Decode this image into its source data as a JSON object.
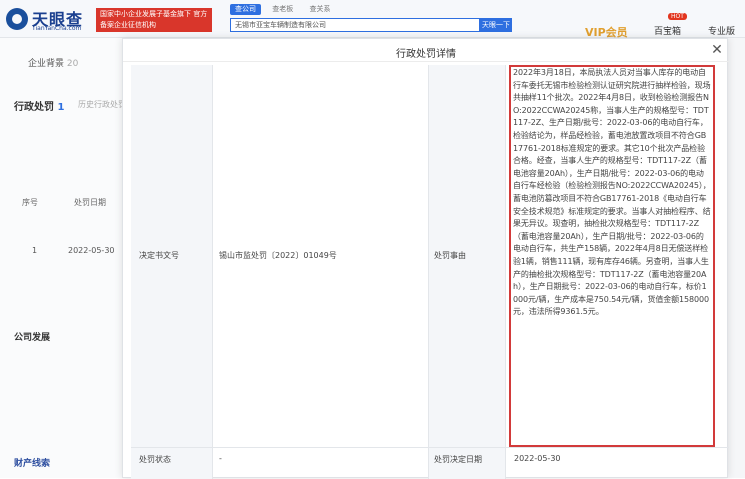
{
  "header": {
    "logo_text": "天眼查",
    "logo_sub": "TianYanCha.com",
    "ad_banner": "国家中小企业发展子基金旗下 官方备案企业征信机构",
    "search_tabs": [
      "查公司",
      "查老板",
      "查关系"
    ],
    "search_value": "无锡市亚宝车辆制造有限公司",
    "search_button": "天眼一下",
    "vip_label": "VIP会员",
    "hot_badge": "HOT",
    "nav_label": "百宝箱",
    "pro_label": "专业版"
  },
  "background": {
    "tab_label": "企业背景",
    "tab_count": "20",
    "section_title": "行政处罚",
    "section_count": "1",
    "section_sub": "历史行政处罚",
    "table_headers": [
      "序号",
      "处罚日期"
    ],
    "table_row": [
      "1",
      "2022-05-30"
    ],
    "section_2": "公司发展",
    "section_3": "财产线索"
  },
  "modal": {
    "title": "行政处罚详情",
    "rows": {
      "decision_label": "决定书文号",
      "decision_value": "锡山市监处罚〔2022〕01049号",
      "reason_label": "处罚事由",
      "reason_text": "2022年3月18日，本局执法人员对当事人库存的电动自行车委托无锡市检验检测认证研究院进行抽样检验，现场共抽样11个批次。2022年4月8日，收到检验检测报告NO:2022CCWA20245称，当事人生产的规格型号：TDT117-2Z、生产日期/批号：2022-03-06的电动自行车，检验结论为，样品经检验，蓄电池放置改项目不符合GB17761-2018标准规定的要求。其它10个批次产品检验合格。经查，当事人生产的规格型号：TDT117-2Z（蓄电池容量20Ah），生产日期/批号：2022-03-06的电动自行车经检验（检验检测报告NO:2022CCWA20245），蓄电池防篡改项目不符合GB17761-2018《电动自行车安全技术规范》标准规定的要求。当事人对抽检程序、结果无异议。现查明，抽检批次规格型号：TDT117-2Z（蓄电池容量20Ah），生产日期/批号：2022-03-06的电动自行车，共生产158辆，2022年4月8日无偿送样检验1辆，销售111辆，现有库存46辆。另查明，当事人生产的抽检批次规格型号：TDT117-2Z（蓄电池容量20Ah），生产日期批号：2022-03-06的电动自行车，标价1000元/辆，生产成本是750.54元/辆，货值金额158000元，违法所得9361.5元。",
      "status_label": "处罚状态",
      "status_value": "-",
      "date_label": "处罚决定日期",
      "date_value": "2022-05-30"
    }
  },
  "colors": {
    "brand_blue": "#1a4f9c",
    "highlight_red": "#d23a3a",
    "ad_red": "#d9362b",
    "vip_gold": "#e1a030"
  }
}
